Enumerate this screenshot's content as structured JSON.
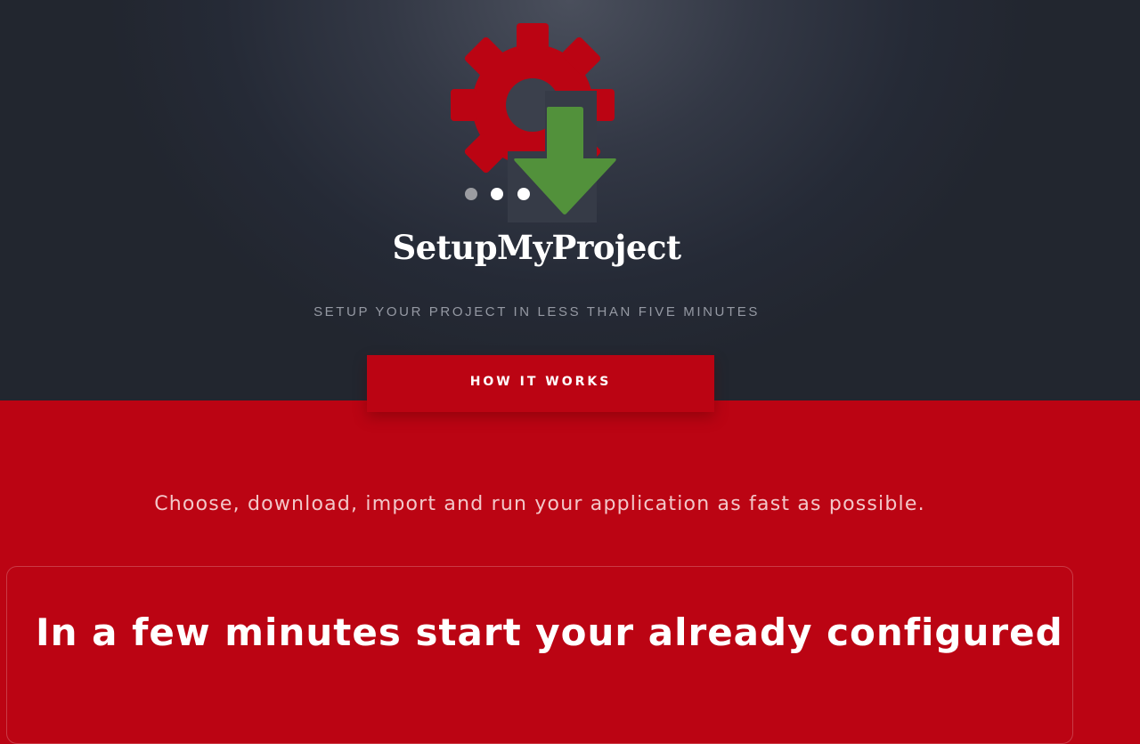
{
  "brand": {
    "name": "SetupMyProject",
    "tagline": "SETUP YOUR PROJECT IN LESS THAN FIVE MINUTES"
  },
  "hero": {
    "how_it_works_label": "HOW IT WORKS"
  },
  "intro": {
    "lead": "Choose, download, import and run your application as fast as possible.",
    "card_title": "In a few minutes start your already configured"
  },
  "colors": {
    "brand_red": "#bb0413",
    "hero_dark": "#252a36",
    "arrow_green": "#52913b"
  },
  "icons": {
    "logo": "gear-download-icon"
  }
}
